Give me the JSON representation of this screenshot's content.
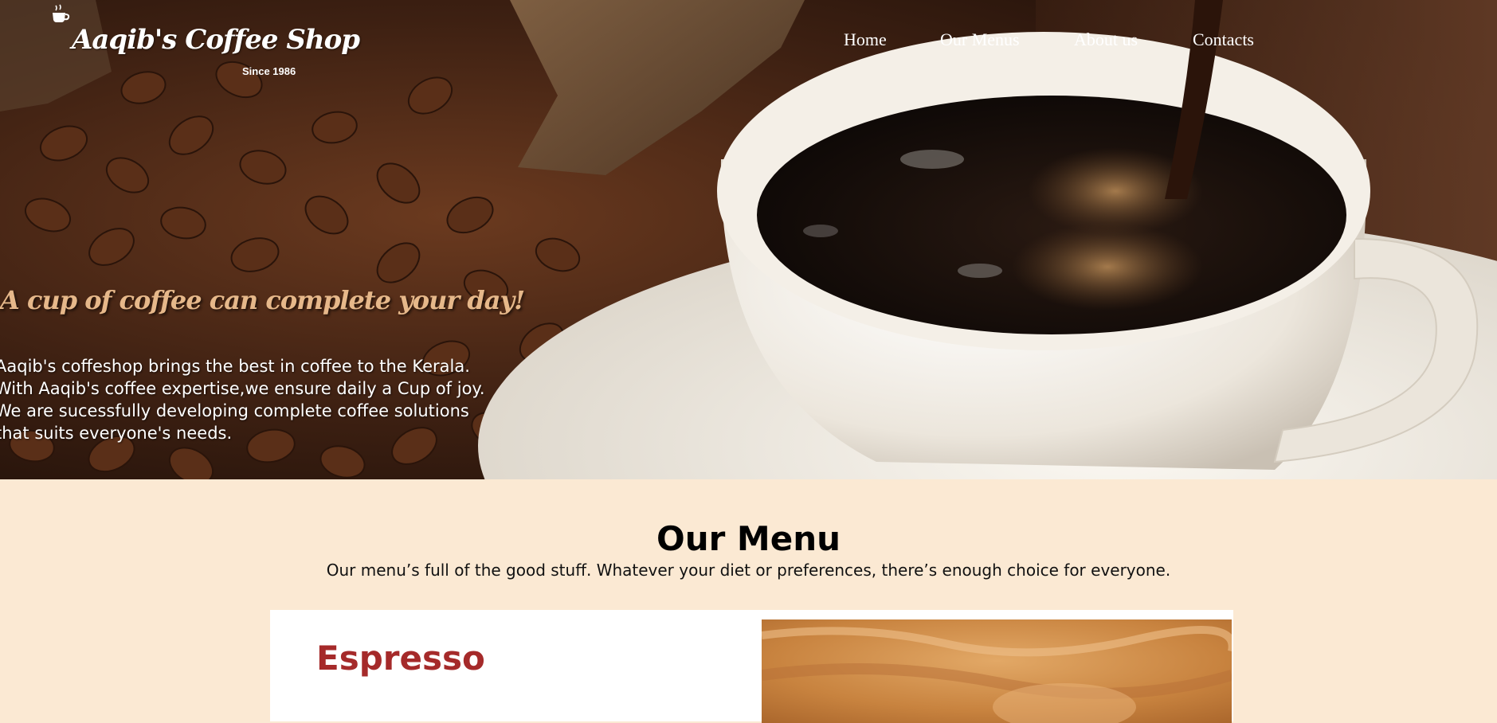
{
  "header": {
    "logo_text": "Aaqib's Coffee Shop",
    "since": "Since 1986",
    "nav": [
      "Home",
      "Our Menus",
      "About us",
      "Contacts"
    ]
  },
  "hero": {
    "tagline": "A cup of coffee can complete your day!",
    "intro_lines": [
      "Aaqib's coffeshop brings the best in coffee to the Kerala.",
      "With Aaqib's coffee expertise,we ensure daily a Cup of joy.",
      "We are sucessfully developing complete coffee solutions",
      "that suits everyone's needs."
    ]
  },
  "menu": {
    "title": "Our Menu",
    "subtitle": "Our menu’s full of the good stuff. Whatever your diet or preferences, there’s enough choice for everyone.",
    "items": [
      {
        "name": "Espresso"
      }
    ]
  },
  "colors": {
    "page_bg": "#fbe9d3",
    "tagline": "#e6b88a",
    "item_title": "#a52a2a"
  }
}
